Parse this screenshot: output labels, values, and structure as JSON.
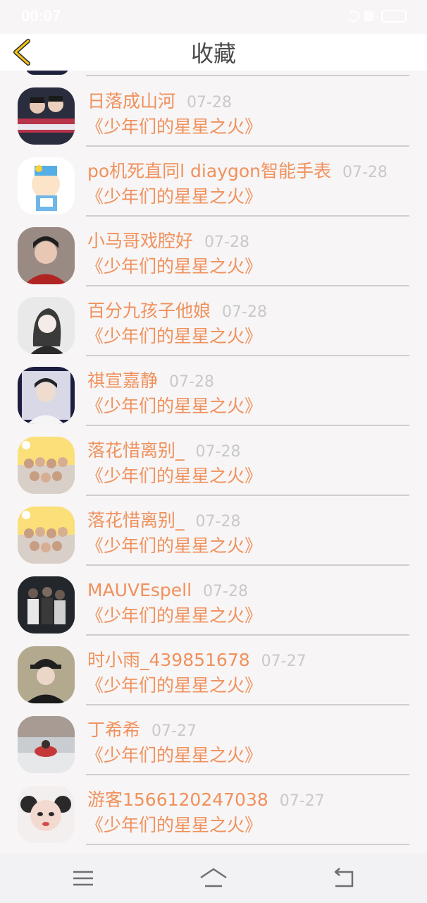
{
  "status_bar": {
    "time": "00:07"
  },
  "header": {
    "title": "收藏"
  },
  "items": [
    {
      "name": "日落成山河",
      "date": "07-28",
      "title": "《少年们的星星之火》"
    },
    {
      "name": "po机死直同l diaygon智能手表",
      "date": "07-28",
      "title": "《少年们的星星之火》"
    },
    {
      "name": "小马哥戏腔好",
      "date": "07-28",
      "title": "《少年们的星星之火》"
    },
    {
      "name": "百分九孩子他娘",
      "date": "07-28",
      "title": "《少年们的星星之火》"
    },
    {
      "name": "祺宣嘉静",
      "date": "07-28",
      "title": "《少年们的星星之火》"
    },
    {
      "name": "落花惜离别_",
      "date": "07-28",
      "title": "《少年们的星星之火》"
    },
    {
      "name": "落花惜离别_",
      "date": "07-28",
      "title": "《少年们的星星之火》"
    },
    {
      "name": "MAUVEspell",
      "date": "07-28",
      "title": "《少年们的星星之火》"
    },
    {
      "name": "时小雨_439851678",
      "date": "07-27",
      "title": "《少年们的星星之火》"
    },
    {
      "name": "丁希希",
      "date": "07-27",
      "title": "《少年们的星星之火》"
    },
    {
      "name": "游客1566120247038",
      "date": "07-27",
      "title": "《少年们的星星之火》"
    }
  ],
  "colors": {
    "accent": "#f0915c",
    "date": "#c9c9c9",
    "back_icon": "#f5c518",
    "divider": "#cfcfcf"
  },
  "icons": {
    "back": "chevron-left-icon",
    "nav_menu": "menu-icon",
    "nav_home": "home-icon",
    "nav_back": "return-icon"
  }
}
